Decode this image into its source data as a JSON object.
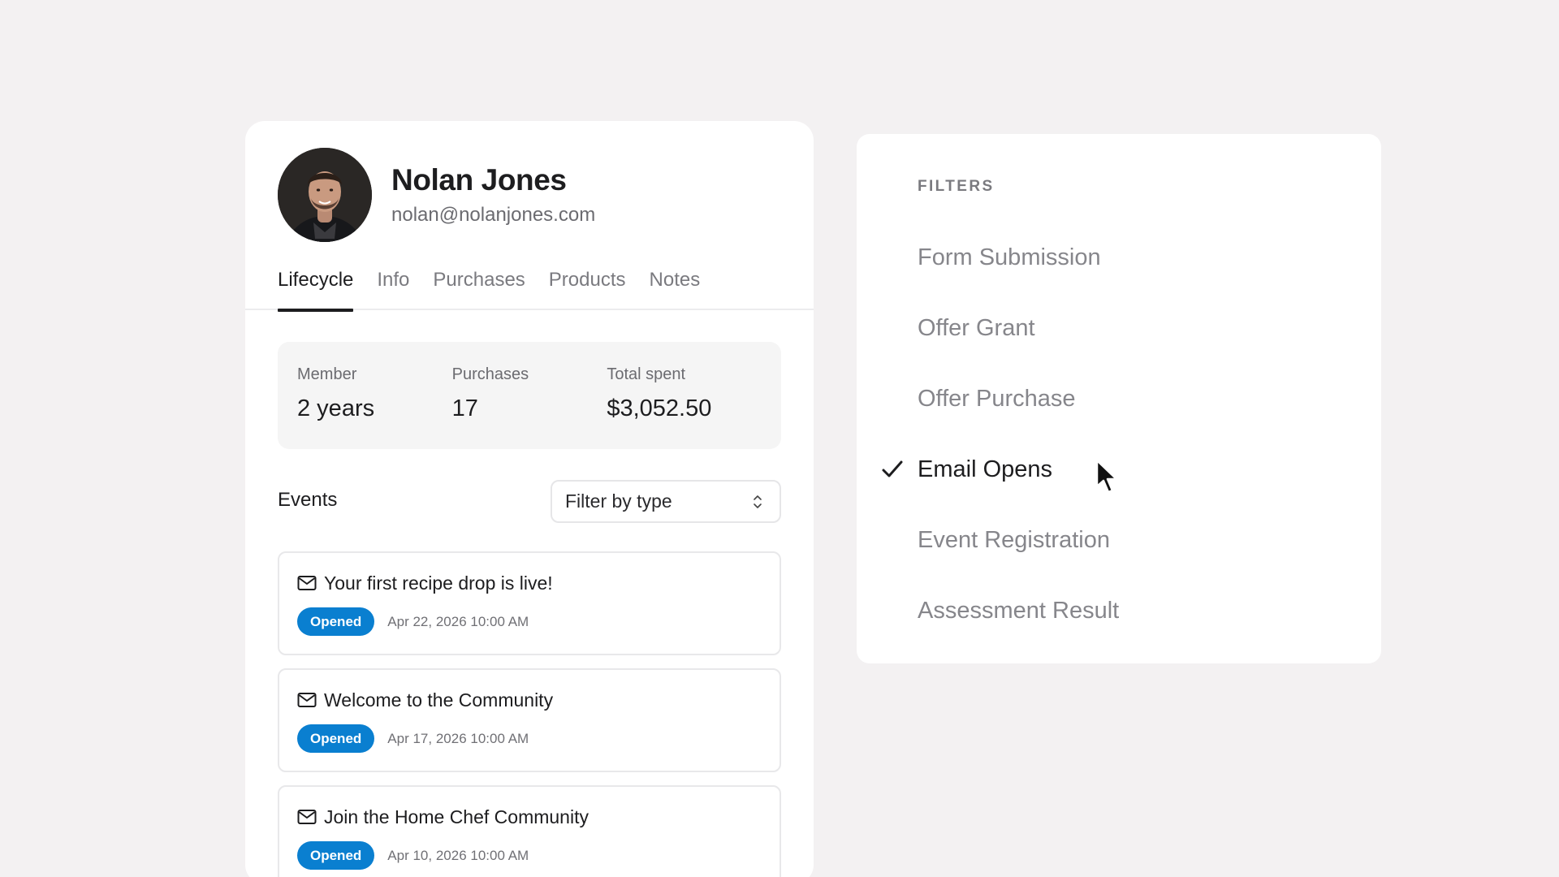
{
  "profile": {
    "name": "Nolan Jones",
    "email": "nolan@nolanjones.com",
    "avatar_icon": "person-portrait"
  },
  "tabs": [
    {
      "label": "Lifecycle",
      "active": true
    },
    {
      "label": "Info",
      "active": false
    },
    {
      "label": "Purchases",
      "active": false
    },
    {
      "label": "Products",
      "active": false
    },
    {
      "label": "Notes",
      "active": false
    }
  ],
  "stats": [
    {
      "label": "Member",
      "value": "2 years"
    },
    {
      "label": "Purchases",
      "value": "17"
    },
    {
      "label": "Total spent",
      "value": "$3,052.50"
    }
  ],
  "events": {
    "title": "Events",
    "filter_label": "Filter by type",
    "items": [
      {
        "icon": "mail-icon",
        "title": "Your first recipe drop is live!",
        "status": "Opened",
        "time": "Apr 22, 2026 10:00 AM"
      },
      {
        "icon": "mail-icon",
        "title": "Welcome to the Community",
        "status": "Opened",
        "time": "Apr 17, 2026 10:00 AM"
      },
      {
        "icon": "mail-icon",
        "title": "Join the Home Chef Community",
        "status": "Opened",
        "time": "Apr 10, 2026 10:00 AM"
      }
    ]
  },
  "filters": {
    "heading": "FILTERS",
    "options": [
      {
        "label": "Form Submission",
        "selected": false
      },
      {
        "label": "Offer Grant",
        "selected": false
      },
      {
        "label": "Offer Purchase",
        "selected": false
      },
      {
        "label": "Email Opens",
        "selected": true
      },
      {
        "label": "Event Registration",
        "selected": false
      },
      {
        "label": "Assessment Result",
        "selected": false
      }
    ]
  },
  "colors": {
    "accent": "#0a7fd0",
    "background": "#f3f1f2",
    "text_primary": "#1d1d1f",
    "text_muted": "#86868b"
  }
}
